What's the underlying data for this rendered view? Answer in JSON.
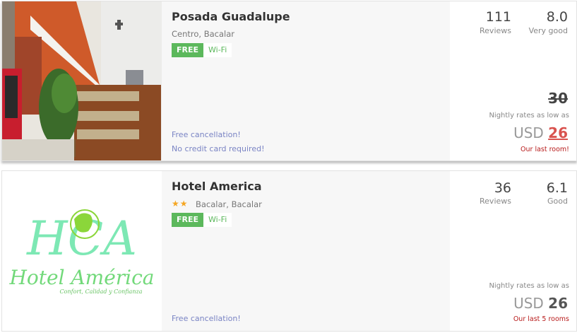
{
  "results": [
    {
      "name": "Posada Guadalupe",
      "location": "Centro, Bacalar",
      "stars": 0,
      "amenity": {
        "free_label": "FREE",
        "name": "Wi-Fi"
      },
      "policies": [
        "Free cancellation!",
        "No credit card required!"
      ],
      "reviews_count": "111",
      "reviews_label": "Reviews",
      "score": "8.0",
      "score_label": "Very good",
      "old_price": "30",
      "rates_label": "Nightly rates as low as",
      "currency": "USD",
      "price": "26",
      "price_color": "#d9534f",
      "scarcity": "Our last room!"
    },
    {
      "name": "Hotel America",
      "location": "Bacalar, Bacalar",
      "stars": 2,
      "stars_text": "★★",
      "amenity": {
        "free_label": "FREE",
        "name": "Wi-Fi"
      },
      "policies": [
        "Free cancellation!"
      ],
      "reviews_count": "36",
      "reviews_label": "Reviews",
      "score": "6.1",
      "score_label": "Good",
      "rates_label": "Nightly rates as low as",
      "currency": "USD",
      "price": "26",
      "price_color": "#555555",
      "scarcity": "Our last 5 rooms",
      "logo": {
        "line1": "Hotel América",
        "tagline": "Confort, Calidad y Confianza",
        "monogram": "HCA"
      }
    }
  ],
  "colors": {
    "accent_green": "#5cb85c",
    "policy_link": "#7a84c4",
    "scarcity_red": "#b81c1c",
    "star": "#f5a623"
  }
}
